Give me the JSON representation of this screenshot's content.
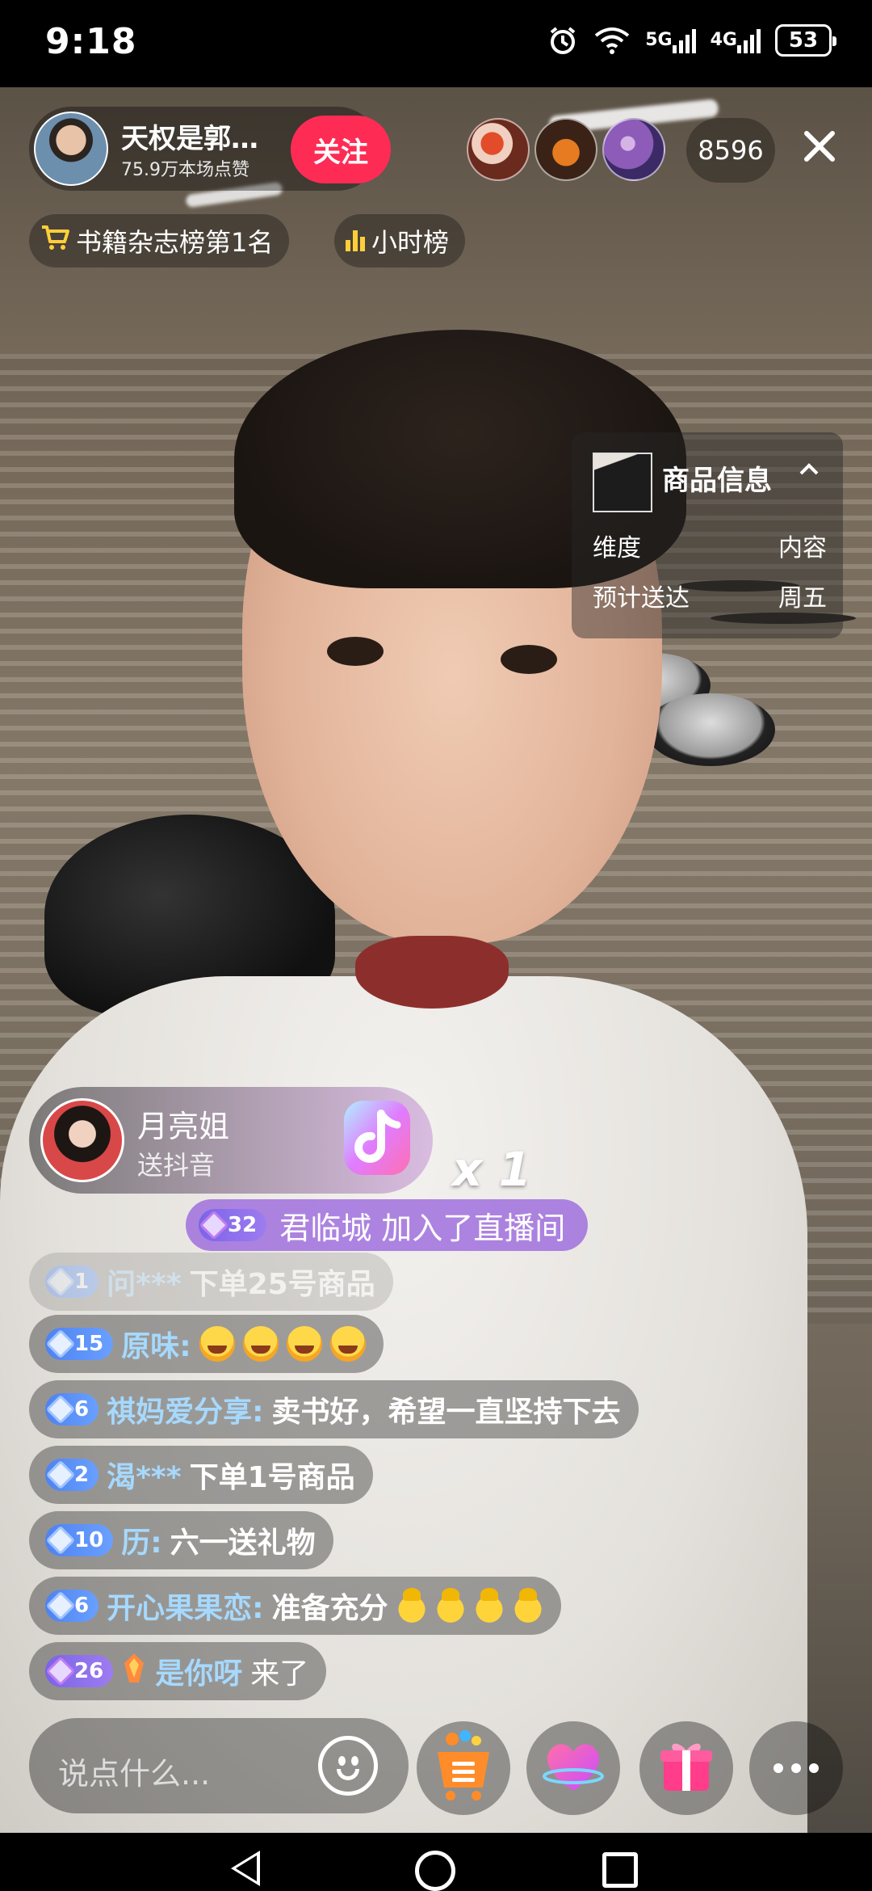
{
  "status_bar": {
    "time": "9:18",
    "network_5g": "5G",
    "network_4g": "4G",
    "battery": "53"
  },
  "anchor": {
    "name": "天权是郭…",
    "likes": "75.9万本场点赞",
    "follow_label": "关注"
  },
  "viewers": {
    "count": "8596"
  },
  "badges": {
    "rank": "书籍杂志榜第1名",
    "hourly": "小时榜"
  },
  "product": {
    "title": "商品信息",
    "rows": [
      {
        "label": "维度",
        "value": "内容"
      },
      {
        "label": "预计送达",
        "value": "周五"
      }
    ]
  },
  "gift": {
    "sender": "月亮姐",
    "action": "送抖音",
    "count": "x 1"
  },
  "join_notice": {
    "level": "32",
    "text": "君临城 加入了直播间"
  },
  "comments": [
    {
      "level": "1",
      "user": "问***",
      "text": "下单25号商品"
    },
    {
      "level": "15",
      "user": "原味:",
      "text": ""
    },
    {
      "level": "6",
      "user": "祺妈爱分享:",
      "text": "卖书好，希望一直坚持下去"
    },
    {
      "level": "2",
      "user": "渴***",
      "text": "下单1号商品"
    },
    {
      "level": "10",
      "user": "历:",
      "text": "六一送礼物"
    },
    {
      "level": "6",
      "user": "开心果果恋:",
      "text": "准备充分"
    },
    {
      "level": "26",
      "user": "是你呀",
      "text": "来了"
    }
  ],
  "input": {
    "placeholder": "说点什么..."
  },
  "icons": {
    "close": "close-icon",
    "cart": "cart-icon",
    "emoji": "emoji-icon",
    "shop": "shopping-cart-icon",
    "heart": "heart-icon",
    "gift": "gift-box-icon",
    "more": "more-icon"
  },
  "colors": {
    "follow": "#fe2c55",
    "username": "#a6d9ff",
    "level_blue": "#4e82f0",
    "level_purple": "#7b64e8",
    "rank_icon": "#ffcf3a"
  }
}
